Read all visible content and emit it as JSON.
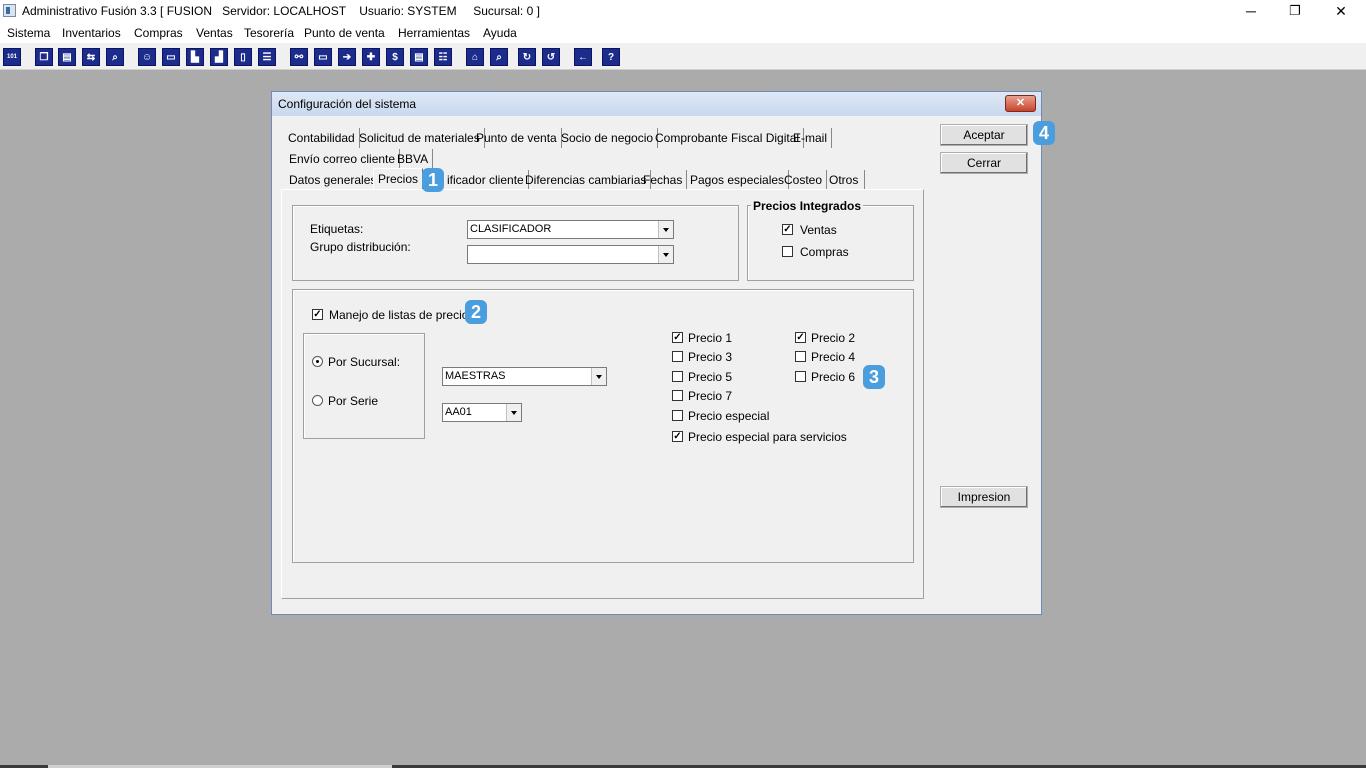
{
  "window": {
    "title": "Administrativo Fusión 3.3 [ FUSION   Servidor: LOCALHOST    Usuario: SYSTEM     Sucursal: 0 ]",
    "minimize": "─",
    "maximize": "❐",
    "close": "✕"
  },
  "menu": [
    "Sistema",
    "Inventarios",
    "Compras",
    "Ventas",
    "Tesorería",
    "Punto de venta",
    "Herramientas",
    "Ayuda"
  ],
  "toolbar_icons": [
    "data-icon",
    "copy-icon",
    "paste-icon",
    "transfer-icon",
    "search-doc-icon",
    "user-icon",
    "folder-icon",
    "print-icon",
    "print-preview-icon",
    "document-icon",
    "list-icon",
    "binoculars-icon",
    "box-icon",
    "export-icon",
    "add-icon",
    "dollar-icon",
    "report-icon",
    "table-icon",
    "home-icon",
    "zoom-icon",
    "refresh-icon",
    "undo-icon",
    "back-icon",
    "help-icon"
  ],
  "dialog": {
    "title": "Configuración del sistema",
    "close_glyph": "✕",
    "tabs_row1": [
      "Contabilidad",
      "Solicitud de materiales",
      "Punto de venta",
      "Socio de negocio",
      "Comprobante Fiscal Digital",
      "E-mail"
    ],
    "tabs_row2": [
      "Envío correo cliente",
      "BBVA"
    ],
    "tabs_row3": [
      "Datos generales",
      "Precios",
      "Clasificador cliente",
      "Diferencias cambiarias",
      "Fechas",
      "Pagos especiales",
      "Costeo",
      "Otros"
    ],
    "tab3_partial": "ificador cliente",
    "active_tab": "Precios",
    "etiquetas_label": "Etiquetas:",
    "etiquetas_value": "CLASIFICADOR",
    "grupo_label": "Grupo distribución:",
    "grupo_value": "",
    "precios_integrados": {
      "legend": "Precios Integrados",
      "ventas": "Ventas",
      "ventas_checked": true,
      "compras": "Compras",
      "compras_checked": false
    },
    "manejo_label": "Manejo de listas de precios",
    "manejo_checked": true,
    "por_sucursal": "Por Sucursal:",
    "por_serie": "Por Serie",
    "sucursal_value": "MAESTRAS",
    "serie_value": "AA01",
    "precios": [
      {
        "label": "Precio 1",
        "checked": true
      },
      {
        "label": "Precio 2",
        "checked": true
      },
      {
        "label": "Precio 3",
        "checked": false
      },
      {
        "label": "Precio 4",
        "checked": false
      },
      {
        "label": "Precio 5",
        "checked": false
      },
      {
        "label": "Precio 6",
        "checked": false
      },
      {
        "label": "Precio 7",
        "checked": false
      },
      {
        "label": "Precio especial",
        "checked": false
      },
      {
        "label": "Precio especial para servicios",
        "checked": true
      }
    ],
    "aceptar": "Aceptar",
    "cerrar": "Cerrar",
    "impresion": "Impresion"
  },
  "badges": [
    "1",
    "2",
    "3",
    "4"
  ],
  "check_glyph": "✓"
}
